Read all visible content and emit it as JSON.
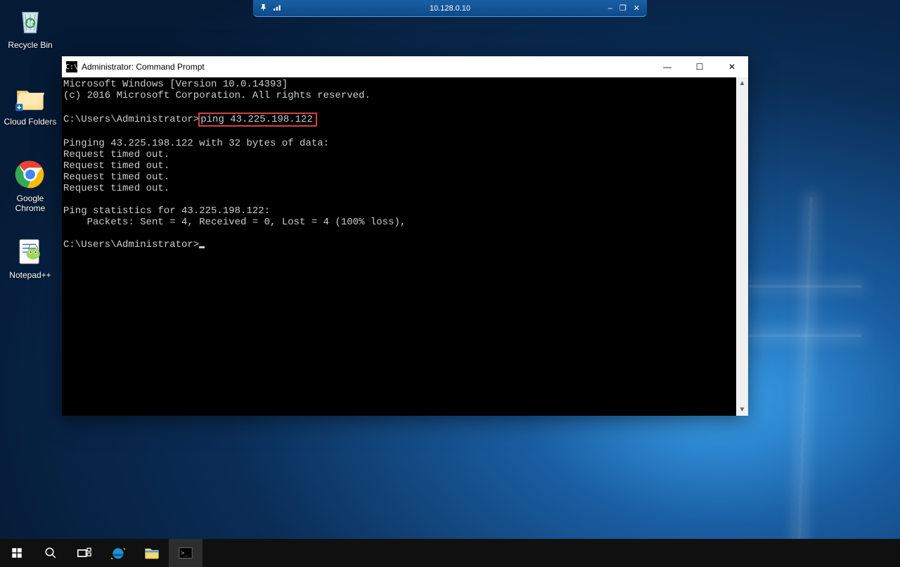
{
  "session_bar": {
    "ip": "10.128.0.10",
    "pin_icon": "pin",
    "signal_icon": "signal",
    "minimize": "–",
    "restore": "❐",
    "close": "✕"
  },
  "desktop_icons": {
    "recycle_bin": "Recycle Bin",
    "cloud_folders": "Cloud Folders",
    "google_chrome": "Google\nChrome",
    "notepadpp": "Notepad++"
  },
  "cmd_window": {
    "title": "Administrator: Command Prompt",
    "icon_text": "C:\\",
    "minimize": "—",
    "maximize": "☐",
    "close": "✕",
    "line1": "Microsoft Windows [Version 10.0.14393]",
    "line2": "(c) 2016 Microsoft Corporation. All rights reserved.",
    "prompt1_pre": "C:\\Users\\Administrator>",
    "prompt1_cmd": "ping 43.225.198.122",
    "out1": "Pinging 43.225.198.122 with 32 bytes of data:",
    "out2": "Request timed out.",
    "out3": "Request timed out.",
    "out4": "Request timed out.",
    "out5": "Request timed out.",
    "stat1": "Ping statistics for 43.225.198.122:",
    "stat2": "    Packets: Sent = 4, Received = 0, Lost = 4 (100% loss),",
    "prompt2": "C:\\Users\\Administrator>",
    "scroll_up": "▲",
    "scroll_down": "▼"
  },
  "taskbar": {
    "start": "start",
    "search": "search",
    "taskview": "taskview",
    "ie": "ie",
    "explorer": "explorer",
    "cmd": "cmd"
  }
}
